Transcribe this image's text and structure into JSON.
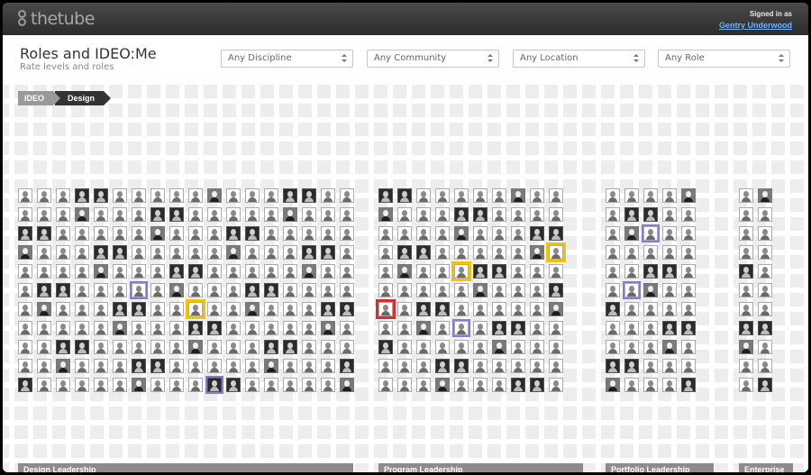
{
  "app": {
    "logo_text": "thetube",
    "signed_in_label": "Signed in as",
    "user_name": "Gentry Underwood"
  },
  "header": {
    "title": "Roles and IDEO:Me",
    "subtitle": "Rate levels and roles"
  },
  "filters": [
    {
      "label": "Any Discipline"
    },
    {
      "label": "Any Community"
    },
    {
      "label": "Any Location"
    },
    {
      "label": "Any Role"
    }
  ],
  "breadcrumb": [
    "IDEO",
    "Design"
  ],
  "roles": [
    {
      "label": "Design Leadership",
      "cols": 18,
      "rows": 11
    },
    {
      "label": "Program Leadership",
      "cols": 10,
      "rows": 11
    },
    {
      "label": "Portfolio Leadership",
      "cols": 5,
      "rows": 11
    },
    {
      "label": "Enterprise",
      "cols": 2,
      "rows": 11
    }
  ],
  "colors": {
    "topbar": "#3a3a3a",
    "link": "#6fb4ff",
    "highlight_yellow": "#f2c400",
    "highlight_blue": "#7f7fd8",
    "highlight_red": "#d43030",
    "role_bar": "#8c8c8c"
  }
}
